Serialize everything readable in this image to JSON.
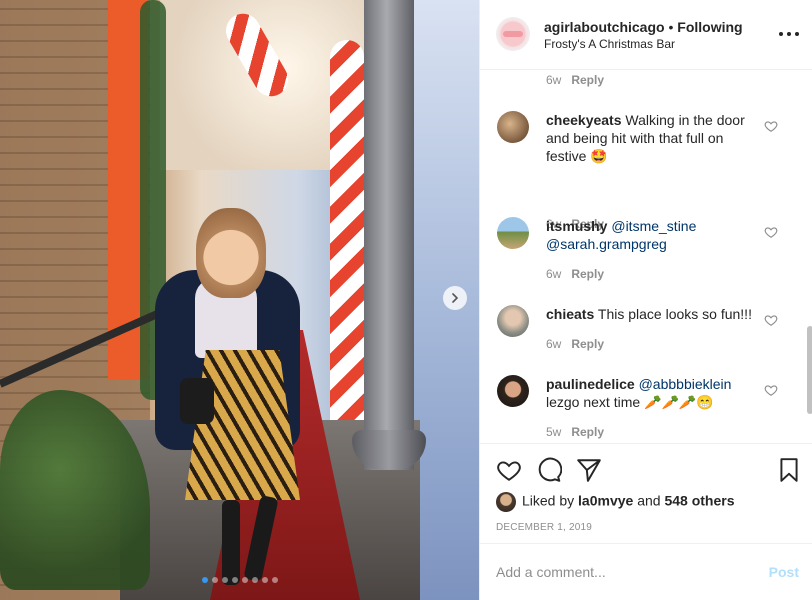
{
  "post": {
    "username": "agirlaboutchicago",
    "separator": "•",
    "follow_status": "Following",
    "location": "Frosty's A Christmas Bar",
    "carousel_dot_count": 8,
    "carousel_active_index": 0
  },
  "comments": [
    {
      "username": "",
      "text": "",
      "time": "6w",
      "reply_label": "Reply"
    },
    {
      "username": "cheekyeats",
      "text": "Walking in the door and being hit with that full on festive 🤩",
      "time": "6w",
      "reply_label": "Reply"
    },
    {
      "username": "itsmushy",
      "mentions": [
        "@itsme_stine",
        "@sarah.grampgreg"
      ],
      "text": "",
      "time": "6w",
      "reply_label": "Reply"
    },
    {
      "username": "chieats",
      "text": "This place looks so fun!!!",
      "time": "6w",
      "reply_label": "Reply"
    },
    {
      "username": "paulinedelice",
      "mention": "@abbbbieklein",
      "text": "lezgo next time 🥕🥕🥕😁",
      "time": "5w",
      "reply_label": "Reply"
    }
  ],
  "likes": {
    "prefix": "Liked by",
    "user": "la0mvye",
    "connector": "and",
    "others": "548 others"
  },
  "date": "DECEMBER 1, 2019",
  "add_comment": {
    "placeholder": "Add a comment...",
    "post_label": "Post"
  },
  "colors": {
    "mention": "#003569",
    "meta": "#8e8e8e",
    "post_disabled": "#b2dffc",
    "carousel_active": "#3897f0"
  },
  "icons": {
    "header_more": "more-horizontal-icon",
    "carousel_next": "chevron-right-icon",
    "like": "heart-icon",
    "comment": "comment-icon",
    "share": "paper-plane-icon",
    "save": "bookmark-icon"
  }
}
